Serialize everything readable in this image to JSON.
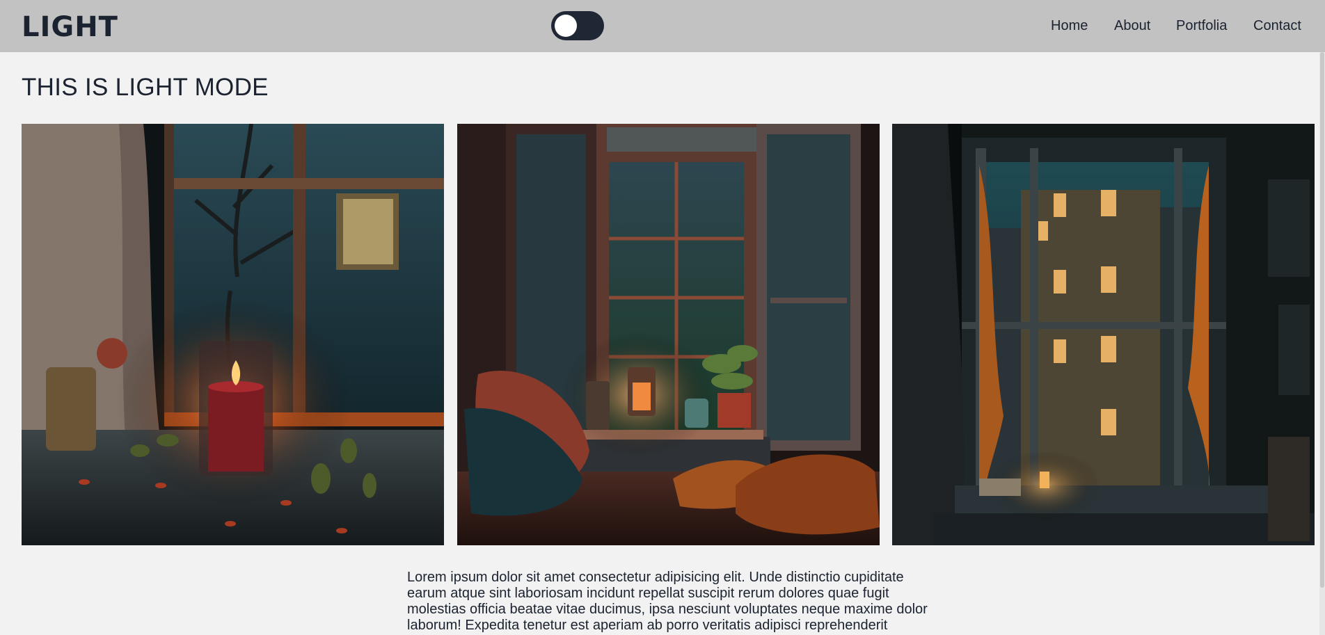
{
  "header": {
    "logo": "LIGHT",
    "theme_toggle": {
      "state": "off"
    },
    "nav": [
      {
        "label": "Home"
      },
      {
        "label": "About"
      },
      {
        "label": "Portfolia"
      },
      {
        "label": "Contact"
      }
    ]
  },
  "main": {
    "title": "THIS IS LIGHT MODE",
    "gallery": [
      {
        "subject": "candle-by-rainy-window"
      },
      {
        "subject": "cozy-window-nook-with-lanterns"
      },
      {
        "subject": "open-window-city-night"
      }
    ],
    "paragraph": "Lorem ipsum dolor sit amet consectetur adipisicing elit. Unde distinctio cupiditate earum atque sint laboriosam incidunt repellat suscipit rerum dolores quae fugit molestias officia beatae vitae ducimus, ipsa nesciunt voluptates neque maxime dolor laborum! Expedita tenetur est aperiam ab porro veritatis adipisci reprehenderit"
  },
  "colors": {
    "navbar_bg": "#c2c2c2",
    "page_bg": "#f2f2f2",
    "text": "#1b2230",
    "toggle_bg": "#1f2735"
  }
}
